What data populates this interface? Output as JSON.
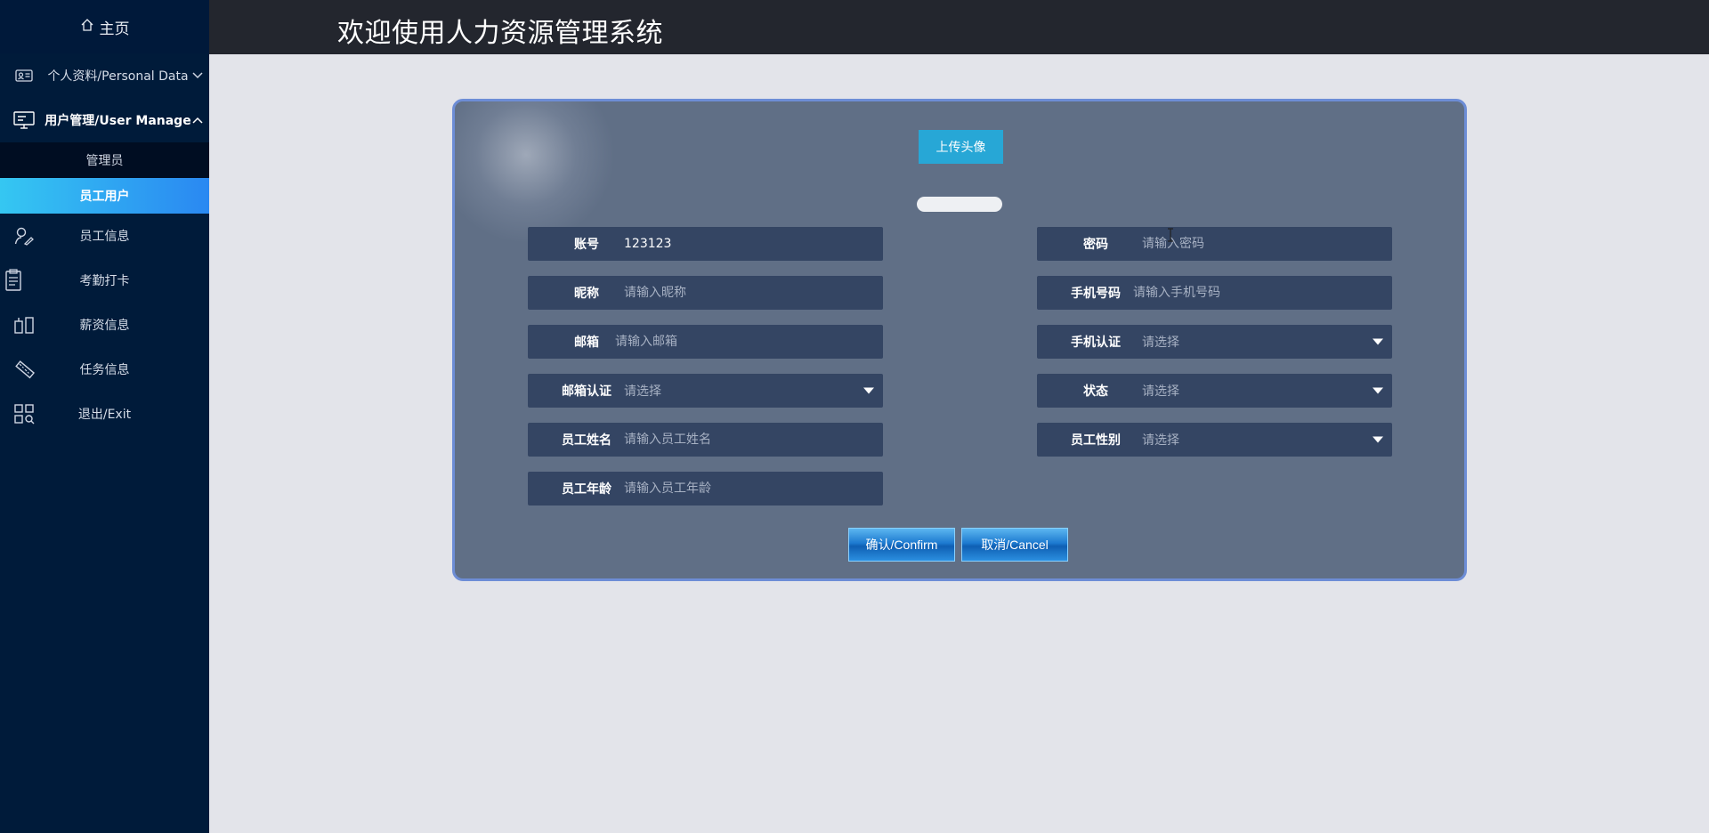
{
  "sidebar": {
    "home": "主页",
    "personal": "个人资料/Personal Data",
    "user_manage": "用户管理/User Manage",
    "sub_admin": "管理员",
    "sub_employee_user": "员工用户",
    "employee_info": "员工信息",
    "attendance": "考勤打卡",
    "salary": "薪资信息",
    "task": "任务信息",
    "exit": "退出/Exit"
  },
  "header": {
    "title": "欢迎使用人力资源管理系统"
  },
  "form": {
    "upload_label": "上传头像",
    "account": {
      "label": "账号",
      "value": "123123"
    },
    "password": {
      "label": "密码",
      "placeholder": "请输入密码"
    },
    "nickname": {
      "label": "昵称",
      "placeholder": "请输入昵称"
    },
    "phone": {
      "label": "手机号码",
      "placeholder": "请输入手机号码"
    },
    "email": {
      "label": "邮箱",
      "placeholder": "请输入邮箱"
    },
    "phone_verify": {
      "label": "手机认证",
      "placeholder": "请选择"
    },
    "email_verify": {
      "label": "邮箱认证",
      "placeholder": "请选择"
    },
    "status": {
      "label": "状态",
      "placeholder": "请选择"
    },
    "emp_name": {
      "label": "员工姓名",
      "placeholder": "请输入员工姓名"
    },
    "emp_gender": {
      "label": "员工性别",
      "placeholder": "请选择"
    },
    "emp_age": {
      "label": "员工年龄",
      "placeholder": "请输入员工年龄"
    },
    "confirm_label": "确认/Confirm",
    "cancel_label": "取消/Cancel"
  },
  "colors": {
    "sidebar_bg": "#001b3a",
    "active_gradient_start": "#35c7f2",
    "active_gradient_end": "#2a88f2",
    "header_bg": "#23262e",
    "card_bg": "#606f86",
    "field_bg": "#344563",
    "upload_bg": "#27a7d6"
  }
}
